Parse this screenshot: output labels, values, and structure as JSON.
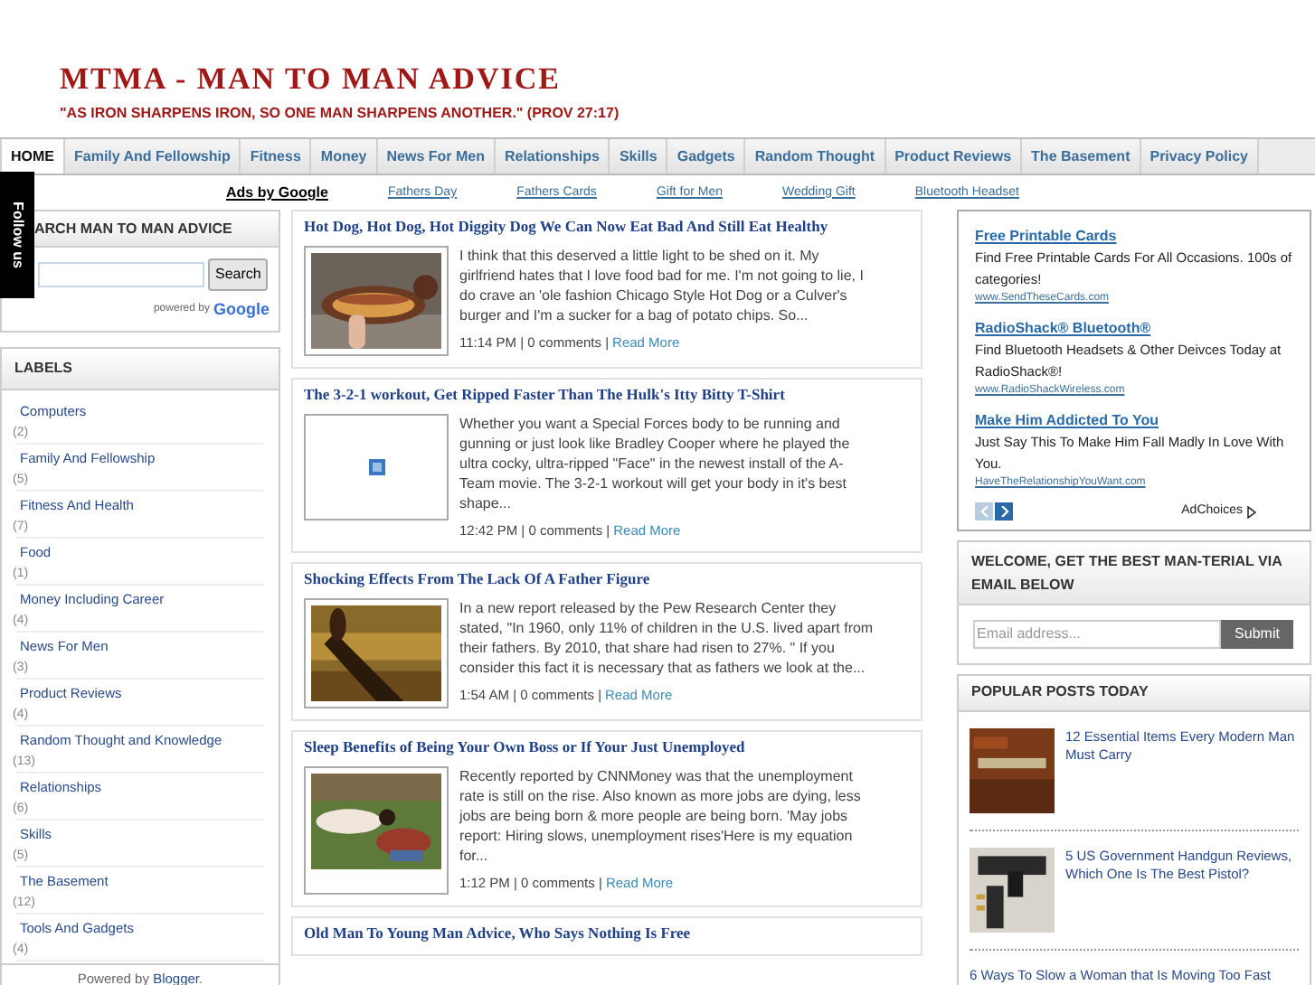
{
  "header": {
    "title": "MTMA - MAN TO MAN ADVICE",
    "tagline": "\"AS IRON SHARPENS IRON, SO ONE MAN SHARPENS ANOTHER.\" (PROV 27:17)"
  },
  "nav": [
    {
      "label": "HOME",
      "selected": true
    },
    {
      "label": "Family And Fellowship",
      "selected": false
    },
    {
      "label": "Fitness",
      "selected": false
    },
    {
      "label": "Money",
      "selected": false
    },
    {
      "label": "News For Men",
      "selected": false
    },
    {
      "label": "Relationships",
      "selected": false
    },
    {
      "label": "Skills",
      "selected": false
    },
    {
      "label": "Gadgets",
      "selected": false
    },
    {
      "label": "Random Thought",
      "selected": false
    },
    {
      "label": "Product Reviews",
      "selected": false
    },
    {
      "label": "The Basement",
      "selected": false
    },
    {
      "label": "Privacy Policy",
      "selected": false
    }
  ],
  "ad_links": {
    "label": "Ads by Google",
    "links": [
      "Fathers Day",
      "Fathers Cards",
      "Gift for Men",
      "Wedding Gift",
      "Bluetooth Headset"
    ]
  },
  "follow_tab": {
    "label": "Follow us"
  },
  "search": {
    "title": "ARCH MAN TO MAN ADVICE",
    "button": "Search",
    "powered_by": "powered by",
    "google": "Google"
  },
  "labels": {
    "title": "LABELS",
    "items": [
      {
        "name": "Computers",
        "count": "(2)"
      },
      {
        "name": "Family And Fellowship",
        "count": "(5)"
      },
      {
        "name": "Fitness And Health",
        "count": "(7)"
      },
      {
        "name": "Food",
        "count": "(1)"
      },
      {
        "name": "Money Including Career",
        "count": "(4)"
      },
      {
        "name": "News For Men",
        "count": "(3)"
      },
      {
        "name": "Product Reviews",
        "count": "(4)"
      },
      {
        "name": "Random Thought and Knowledge",
        "count": "(13)"
      },
      {
        "name": "Relationships",
        "count": "(6)"
      },
      {
        "name": "Skills",
        "count": "(5)"
      },
      {
        "name": "The Basement",
        "count": "(12)"
      },
      {
        "name": "Tools And Gadgets",
        "count": "(4)"
      }
    ]
  },
  "footer": {
    "text": "Powered by",
    "link": "Blogger",
    "end": "."
  },
  "posts": [
    {
      "title": "Hot Dog, Hot Dog, Hot Diggity Dog We Can Now Eat Bad And Still Eat Healthy",
      "excerpt": "I think that this deserved a little light to be shed on it. My girlfriend hates that I love food bad for me. I'm not going to lie, I do crave an 'ole fashion Chicago Style Hot Dog or a Culver's burger and I'm a sucker for a bag of potato chips. So...",
      "meta": "11:14 PM | 0 comments |",
      "read_more": "Read More"
    },
    {
      "title": "The 3-2-1 workout, Get Ripped Faster Than The Hulk's Itty Bitty T-Shirt",
      "image": {
        "kind": "broken"
      },
      "excerpt": "Whether you want a Special Forces body to be running and gunning or just look like Bradley Cooper where he played the ultra cocky, ultra-ripped \"Face\" in the newest install of the A-Team movie. The 3-2-1 workout will get your body in it's best shape...",
      "meta": "12:42 PM | 0 comments |",
      "read_more": "Read More"
    },
    {
      "title": "Shocking Effects From The Lack Of A Father Figure",
      "excerpt": "In a new report released by the Pew Research Center they stated, \"In 1960, only 11% of children in the U.S. lived apart from their fathers. By 2010, that share had risen to 27%. \" If you consider this fact it is necessary that as fathers we look at the...",
      "meta": "1:54 AM | 0 comments |",
      "read_more": "Read More"
    },
    {
      "title": "Sleep Benefits of Being Your Own Boss or If Your Just Unemployed",
      "excerpt": "Recently reported by CNNMoney was that the unemployment rate is still on the rise.  Also known as more jobs are dying, less jobs are being born & more people are being born. 'May jobs report: Hiring slows, unemployment rises'Here is my equation for...",
      "meta": "1:12 PM | 0 comments |",
      "read_more": "Read More"
    },
    {
      "title": "Old Man To Young Man Advice, Who Says Nothing Is Free"
    }
  ],
  "ads": {
    "items": [
      {
        "title": "Free Printable Cards",
        "text": "Find Free Printable Cards For All Occasions. 100s of categories!",
        "url": "www.SendTheseCards.com"
      },
      {
        "title": "RadioShack® Bluetooth®",
        "text": "Find Bluetooth Headsets & Other Deivces Today at RadioShack®!",
        "url": "www.RadioShackWireless.com"
      },
      {
        "title": "Make Him Addicted To You",
        "text": "Just Say This To Make Him Fall Madly In Love With You.",
        "url": "HaveTheRelationshipYouWant.com"
      }
    ],
    "prev_disabled": true,
    "next_disabled": false,
    "adchoices": "AdChoices"
  },
  "subscribe": {
    "title": "WELCOME, GET THE BEST MAN-TERIAL VIA EMAIL BELOW",
    "placeholder": "Email address...",
    "button": "Submit"
  },
  "popular": {
    "title": "POPULAR POSTS TODAY",
    "items": [
      {
        "title": "12 Essential Items Every Modern Man Must Carry"
      },
      {
        "title": "5 US Government Handgun Reviews, Which One Is The Best Pistol?"
      },
      {
        "title": "6 Ways To Slow a Woman that Is Moving Too Fast"
      }
    ]
  }
}
